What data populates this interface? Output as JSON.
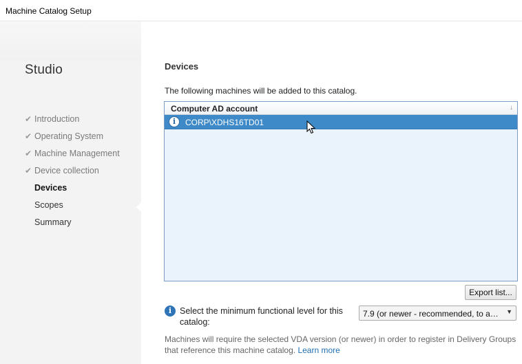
{
  "window": {
    "title": "Machine Catalog Setup"
  },
  "sidebar": {
    "app_name": "Studio",
    "steps": [
      {
        "label": "Introduction",
        "done": true
      },
      {
        "label": "Operating System",
        "done": true
      },
      {
        "label": "Machine Management",
        "done": true
      },
      {
        "label": "Device collection",
        "done": true
      },
      {
        "label": "Devices",
        "done": false,
        "active": true
      },
      {
        "label": "Scopes",
        "done": false
      },
      {
        "label": "Summary",
        "done": false
      }
    ],
    "check_glyph": "✔"
  },
  "main": {
    "section_title": "Devices",
    "description": "The following machines will be added to this catalog.",
    "list": {
      "column_header": "Computer AD account",
      "rows": [
        {
          "account": "CORP\\XDHS16TD01",
          "icon": "info-icon",
          "selected": true
        }
      ]
    },
    "export_button": "Export list...",
    "functional_level": {
      "label": "Select the minimum functional level for this catalog:",
      "selected": "7.9 (or newer - recommended, to acc..."
    },
    "footnote": {
      "text": "Machines will require the selected VDA version (or newer) in order to register in Delivery Groups that reference this machine catalog.",
      "link": "Learn more"
    }
  },
  "colors": {
    "selection": "#3e8ac9",
    "list_background": "#eaf3fc",
    "link": "#1f6fb2",
    "info_icon": "#2e74b7"
  }
}
